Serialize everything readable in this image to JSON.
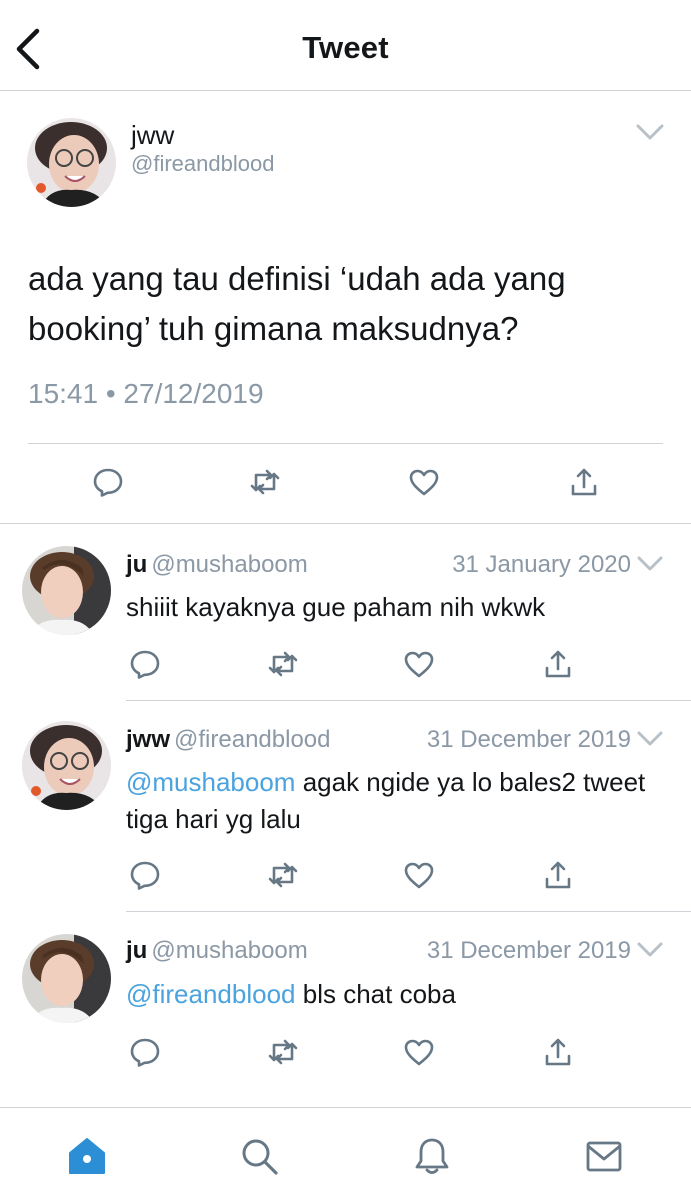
{
  "header": {
    "title": "Tweet"
  },
  "main_tweet": {
    "name": "jww",
    "handle": "@fireandblood",
    "text": "ada yang tau definisi ‘udah ada yang booking’ tuh gimana maksudnya?",
    "timestamp": "15:41 • 27/12/2019"
  },
  "replies": [
    {
      "name": "ju",
      "handle": "@mushaboom",
      "date": "31 January 2020",
      "mention": "",
      "text": "shiiit kayaknya gue paham nih wkwk"
    },
    {
      "name": "jww",
      "handle": "@fireandblood",
      "date": "31 December 2019",
      "mention": "@mushaboom",
      "text": " agak ngide ya lo bales2 tweet tiga hari yg lalu"
    },
    {
      "name": "ju",
      "handle": "@mushaboom",
      "date": "31 December 2019",
      "mention": "@fireandblood",
      "text": " bls chat coba"
    }
  ],
  "icons": {
    "back": "chevron-left-icon",
    "caret": "chevron-down-icon",
    "reply": "comment-icon",
    "retweet": "retweet-icon",
    "like": "heart-icon",
    "share": "share-icon",
    "tabs": [
      "home-icon",
      "search-icon",
      "bell-icon",
      "mail-icon"
    ]
  },
  "colors": {
    "accent": "#4aa3df",
    "text": "#14171a",
    "secondary": "#8b98a5",
    "divider": "#d0d4d8",
    "icon": "#667786"
  }
}
